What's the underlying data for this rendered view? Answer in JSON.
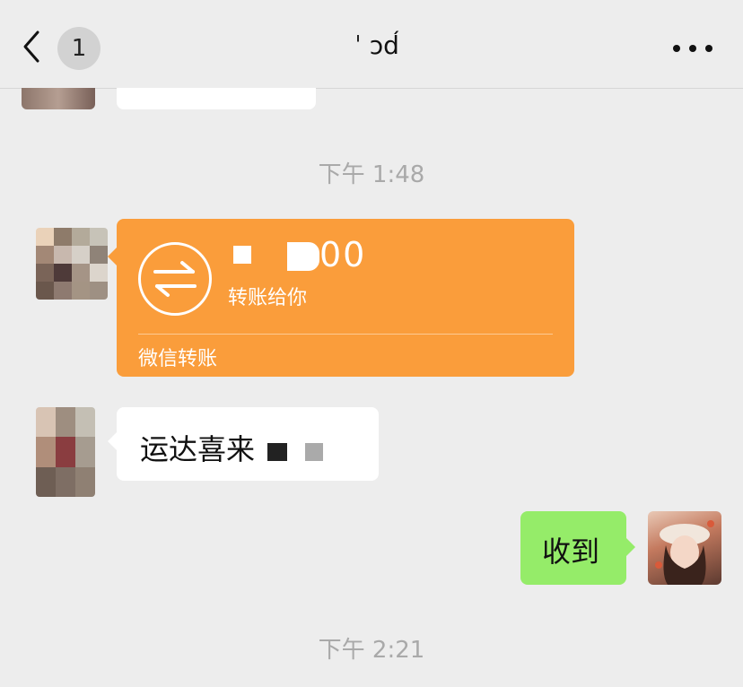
{
  "header": {
    "unread_count": "1",
    "title_fragment": "ˈ ɔd́",
    "back_icon": "chevron-left-icon",
    "more_icon": "more-horizontal-icon"
  },
  "timestamps": [
    "下午 1:48",
    "下午 2:21"
  ],
  "messages": {
    "transfer": {
      "amount": "00",
      "subtitle": "转账给你",
      "footer": "微信转账",
      "color": "#fa9d3b"
    },
    "incoming_text": "运达喜来",
    "outgoing_text": "收到"
  },
  "colors": {
    "background": "#ededed",
    "bubble_out": "#95ec69",
    "bubble_in": "#ffffff",
    "timestamp": "#a9a9a9"
  }
}
